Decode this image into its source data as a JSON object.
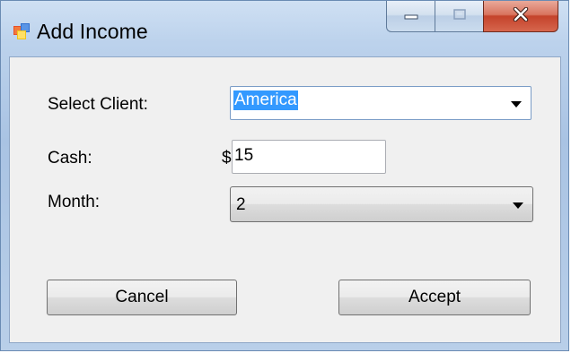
{
  "window": {
    "title": "Add Income",
    "icon": "app-form-icon",
    "buttons": [
      "minimize-icon",
      "maximize-icon",
      "close-icon"
    ]
  },
  "form": {
    "client_label": "Select Client:",
    "client_value": "America",
    "cash_label": "Cash:",
    "currency_symbol": "$",
    "cash_value": "15",
    "month_label": "Month:",
    "month_value": "2"
  },
  "actions": {
    "cancel_label": "Cancel",
    "accept_label": "Accept"
  },
  "colors": {
    "selection_highlight": "#3399ff",
    "close_button": "#c4432b",
    "form_background": "#f0f0f0"
  }
}
